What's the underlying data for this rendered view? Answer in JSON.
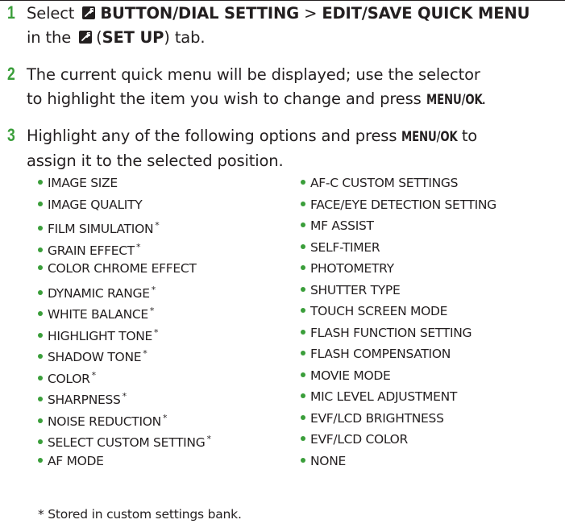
{
  "step1": {
    "number": "1",
    "select": "Select",
    "menu_item": "BUTTON/DIAL SETTING",
    "separator": ">",
    "submenu_item": "EDIT/SAVE QUICK MENU",
    "in_the": "in the",
    "tab_name": "SET UP",
    "tab_suffix": "tab."
  },
  "step2": {
    "number": "2",
    "text_line1": "The current quick menu will be displayed; use the selector",
    "text_line2": "to highlight the item you wish to change and press",
    "button": "MENU/OK",
    "end": "."
  },
  "step3": {
    "number": "3",
    "text_part1": "Highlight any of the following options and press",
    "button": "MENU/OK",
    "text_part2": "to",
    "text_line2": "assign it to the selected position."
  },
  "options_left": [
    {
      "label": "IMAGE SIZE",
      "starred": false
    },
    {
      "label": "IMAGE QUALITY",
      "starred": false
    },
    {
      "label": "FILM SIMULATION",
      "starred": true
    },
    {
      "label": "GRAIN EFFECT",
      "starred": true
    },
    {
      "label": "COLOR CHROME EFFECT",
      "starred": false
    },
    {
      "label": "DYNAMIC RANGE",
      "starred": true
    },
    {
      "label": "WHITE BALANCE",
      "starred": true
    },
    {
      "label": "HIGHLIGHT TONE",
      "starred": true
    },
    {
      "label": "SHADOW TONE",
      "starred": true
    },
    {
      "label": "COLOR",
      "starred": true
    },
    {
      "label": "SHARPNESS",
      "starred": true
    },
    {
      "label": "NOISE REDUCTION",
      "starred": true
    },
    {
      "label": "SELECT CUSTOM SETTING",
      "starred": true
    },
    {
      "label": "AF MODE",
      "starred": false
    }
  ],
  "options_right": [
    {
      "label": "AF-C CUSTOM SETTINGS",
      "starred": false
    },
    {
      "label": "FACE/EYE DETECTION SETTING",
      "starred": false
    },
    {
      "label": "MF ASSIST",
      "starred": false
    },
    {
      "label": "SELF-TIMER",
      "starred": false
    },
    {
      "label": "PHOTOMETRY",
      "starred": false
    },
    {
      "label": "SHUTTER TYPE",
      "starred": false
    },
    {
      "label": "TOUCH SCREEN MODE",
      "starred": false
    },
    {
      "label": "FLASH FUNCTION SETTING",
      "starred": false
    },
    {
      "label": "FLASH COMPENSATION",
      "starred": false
    },
    {
      "label": "MOVIE MODE",
      "starred": false
    },
    {
      "label": "MIC LEVEL ADJUSTMENT",
      "starred": false
    },
    {
      "label": "EVF/LCD BRIGHTNESS",
      "starred": false
    },
    {
      "label": "EVF/LCD COLOR",
      "starred": false
    },
    {
      "label": "NONE",
      "starred": false
    }
  ],
  "star_mark": "*",
  "footnote": "* Stored in custom settings bank.",
  "colors": {
    "accent": "#3a9e3a",
    "text": "#231f20",
    "background": "#ffffff"
  },
  "icons": {
    "setup_tab": "wrench-icon"
  }
}
